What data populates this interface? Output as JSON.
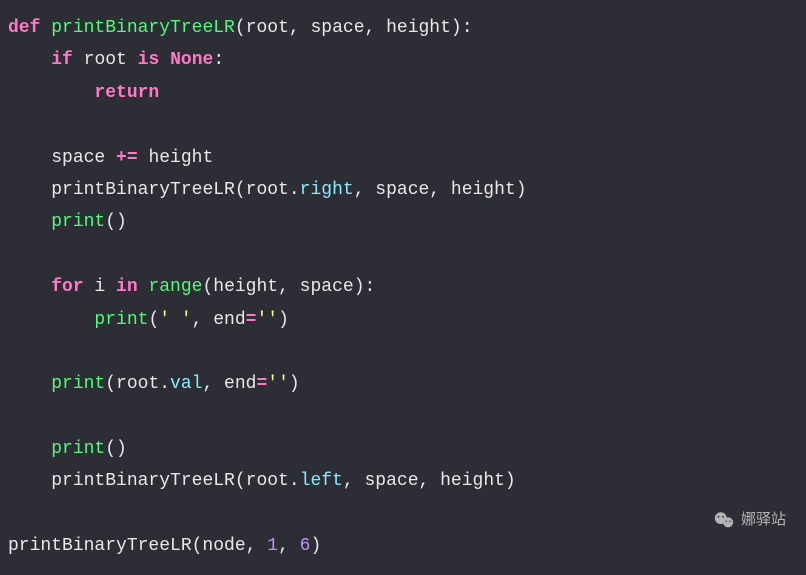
{
  "code": {
    "line1": {
      "def": "def",
      "funcname": "printBinaryTreeLR",
      "open": "(",
      "params": "root, space, height",
      "close": "):"
    },
    "line2": {
      "indent": "    ",
      "if_kw": "if",
      "sp1": " ",
      "var": "root",
      "sp2": " ",
      "is_kw": "is",
      "sp3": " ",
      "none_kw": "None",
      "colon": ":"
    },
    "line3": {
      "indent": "        ",
      "return_kw": "return"
    },
    "line5": {
      "indent": "    ",
      "var": "space ",
      "op": "+=",
      "rest": " height"
    },
    "line6": {
      "indent": "    ",
      "call": "printBinaryTreeLR(root.",
      "prop": "right",
      "rest": ", space, height)"
    },
    "line7": {
      "indent": "    ",
      "print_kw": "print",
      "parens": "()"
    },
    "line9": {
      "indent": "    ",
      "for_kw": "for",
      "sp1": " i ",
      "in_kw": "in",
      "sp2": " ",
      "range_kw": "range",
      "args": "(height, space):"
    },
    "line10": {
      "indent": "        ",
      "print_kw": "print",
      "open": "(",
      "str": "' '",
      "comma": ", end",
      "eq": "=",
      "str2": "''",
      "close": ")"
    },
    "line12": {
      "indent": "    ",
      "print_kw": "print",
      "open": "(root.",
      "prop": "val",
      "mid": ", end",
      "eq": "=",
      "str": "''",
      "close": ")"
    },
    "line14": {
      "indent": "    ",
      "print_kw": "print",
      "parens": "()"
    },
    "line15": {
      "indent": "    ",
      "call": "printBinaryTreeLR(root.",
      "prop": "left",
      "rest": ", space, height)"
    },
    "line17": {
      "call": "printBinaryTreeLR(node, ",
      "num1": "1",
      "comma": ", ",
      "num2": "6",
      "close": ")"
    }
  },
  "watermark": {
    "text": "娜驿站"
  }
}
